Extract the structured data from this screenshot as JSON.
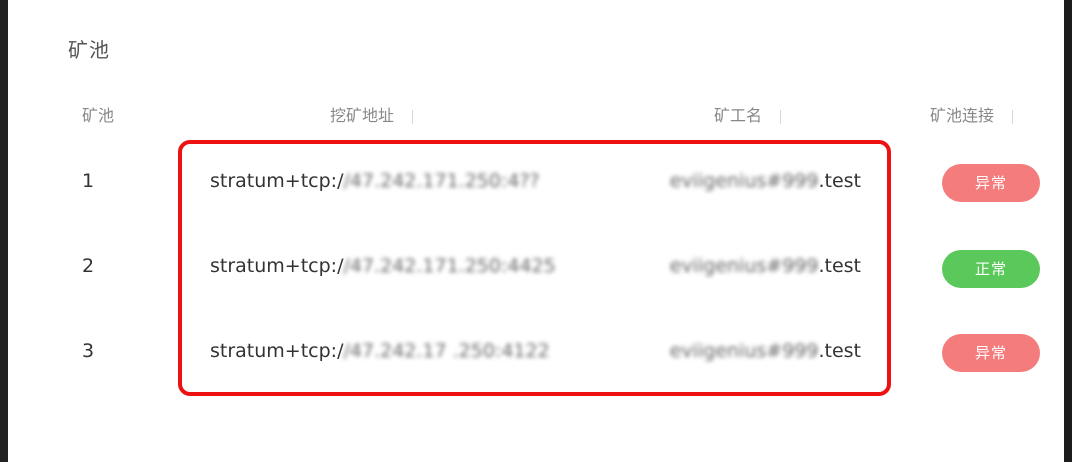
{
  "panel": {
    "title": "矿池"
  },
  "table": {
    "headers": [
      "矿池",
      "挖矿地址",
      "矿工名",
      "矿池连接"
    ],
    "rows": [
      {
        "index": "1",
        "address_prefix": "stratum+tcp:/",
        "address_blurred": "/47.242.171.250:4??",
        "worker_blurred": "eviigenius#999",
        "worker_suffix": ".test",
        "status": "异常",
        "status_type": "bad"
      },
      {
        "index": "2",
        "address_prefix": "stratum+tcp:/",
        "address_blurred": "/47.242.171.250:4425",
        "worker_blurred": "eviigenius#999",
        "worker_suffix": ".test",
        "status": "正常",
        "status_type": "ok"
      },
      {
        "index": "3",
        "address_prefix": "stratum+tcp:/",
        "address_blurred": "/47.242.17 .250:4122",
        "worker_blurred": "eviigenius#999",
        "worker_suffix": ".test",
        "status": "异常",
        "status_type": "bad"
      }
    ]
  },
  "colors": {
    "highlight_border": "#ee1111",
    "badge_bad": "#f47c7c",
    "badge_ok": "#5bc85b"
  }
}
